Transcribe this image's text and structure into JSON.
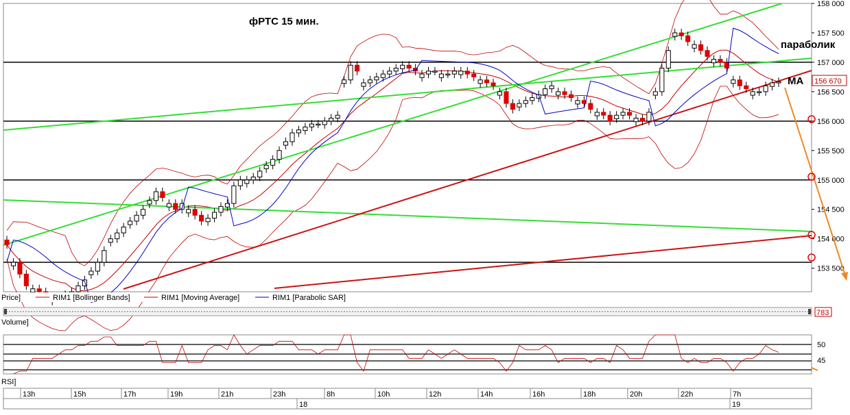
{
  "header": {
    "title": "фРТС   15 мин."
  },
  "annotations": {
    "parabolic": "параболик",
    "ma": "MA"
  },
  "price_scale": {
    "ticks": [
      "158 000",
      "157 500",
      "157 000",
      "156 500",
      "156 000",
      "155 500",
      "155 000",
      "154 500",
      "154 000",
      "153 500"
    ],
    "current_price": "156 670"
  },
  "legend": {
    "price": "Price]",
    "items": [
      {
        "label": "RIM1 [Bollinger Bands]",
        "color": "#c00000"
      },
      {
        "label": "RIM1 [Moving Average]",
        "color": "#c00000"
      },
      {
        "label": "RIM1 [Parabolic SAR]",
        "color": "#0000c0"
      }
    ]
  },
  "scrollbar": {
    "value": "783"
  },
  "volume_panel": {
    "label": "Volume]"
  },
  "rsi_panel": {
    "label": "RSI]",
    "ticks": [
      "50",
      "45"
    ]
  },
  "time_axis": {
    "hours": [
      "13h",
      "15h",
      "17h",
      "19h",
      "21h",
      "23h",
      "8h",
      "10h",
      "12h",
      "14h",
      "16h",
      "18h",
      "20h",
      "22h",
      "7h"
    ],
    "days": [
      "18",
      "19"
    ]
  },
  "colors": {
    "up": "#ffffff",
    "down": "#e00000",
    "green_line": "#33dd33",
    "trend_red": "#cc1111",
    "arrow": "#ee8822"
  },
  "chart_data": {
    "type": "candlestick",
    "title": "фРТС   15 мин.",
    "ylim": [
      153100,
      158000
    ],
    "horizontal_levels": [
      157000,
      156000,
      155000,
      153600
    ],
    "last_price": 156670,
    "closes": [
      153900,
      153600,
      153400,
      153200,
      153150,
      153100,
      153050,
      153000,
      153000,
      153050,
      153100,
      153200,
      153300,
      153450,
      153600,
      153800,
      154000,
      154100,
      154200,
      154300,
      154400,
      154500,
      154650,
      154800,
      154700,
      154600,
      154500,
      154600,
      154500,
      154400,
      154300,
      154350,
      154450,
      154550,
      154600,
      154900,
      155000,
      155000,
      155050,
      155150,
      155250,
      155350,
      155500,
      155650,
      155800,
      155850,
      155900,
      155950,
      155950,
      156000,
      156050,
      156100,
      156700,
      156950,
      156850,
      156650,
      156700,
      156750,
      156800,
      156850,
      156900,
      156950,
      156900,
      156850,
      156800,
      156850,
      156850,
      156800,
      156800,
      156850,
      156850,
      156800,
      156750,
      156700,
      156650,
      156600,
      156500,
      156300,
      156200,
      156300,
      156350,
      156400,
      156450,
      156550,
      156600,
      156500,
      156450,
      156400,
      156350,
      156300,
      156200,
      156150,
      156100,
      156000,
      156100,
      156150,
      156100,
      156050,
      156000,
      156150,
      156500,
      156900,
      157200,
      157500,
      157450,
      157350,
      157300,
      157200,
      157100,
      157050,
      157000,
      156900,
      156700,
      156600,
      156550,
      156500,
      156500,
      156600,
      156650,
      156670
    ]
  }
}
